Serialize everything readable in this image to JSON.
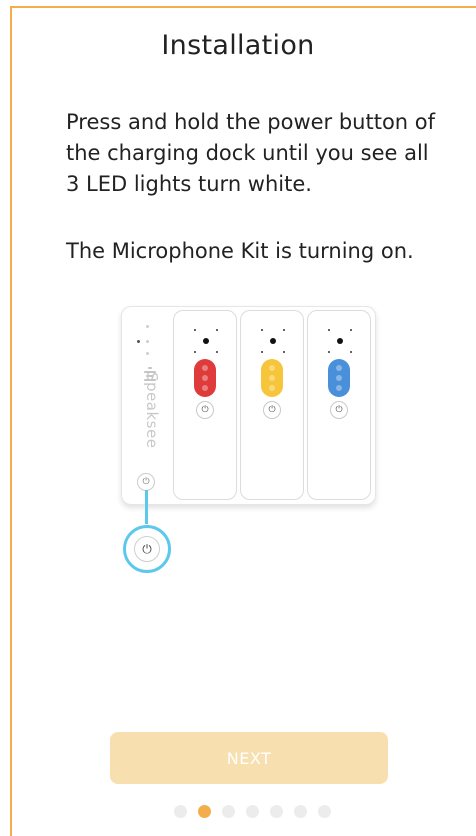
{
  "header": {
    "title": "Installation"
  },
  "instructions": {
    "paragraph_1": "Press and hold the power button of the charging dock until you see all 3 LED lights turn white.",
    "paragraph_2": "The Microphone Kit is turning on."
  },
  "illustration": {
    "brand_text": "Speaksee",
    "slots": [
      {
        "name": "slot-red",
        "color": "#E03B3B"
      },
      {
        "name": "slot-yellow",
        "color": "#F6C53A"
      },
      {
        "name": "slot-blue",
        "color": "#4A8FD9"
      }
    ],
    "highlight_color": "#5CC8EC",
    "power_icon": "power-icon"
  },
  "footer": {
    "next_label": "NEXT",
    "pager": {
      "total": 7,
      "current": 2
    }
  },
  "colors": {
    "accent": "#F3AE4B",
    "button_bg": "#F8DFB0"
  }
}
